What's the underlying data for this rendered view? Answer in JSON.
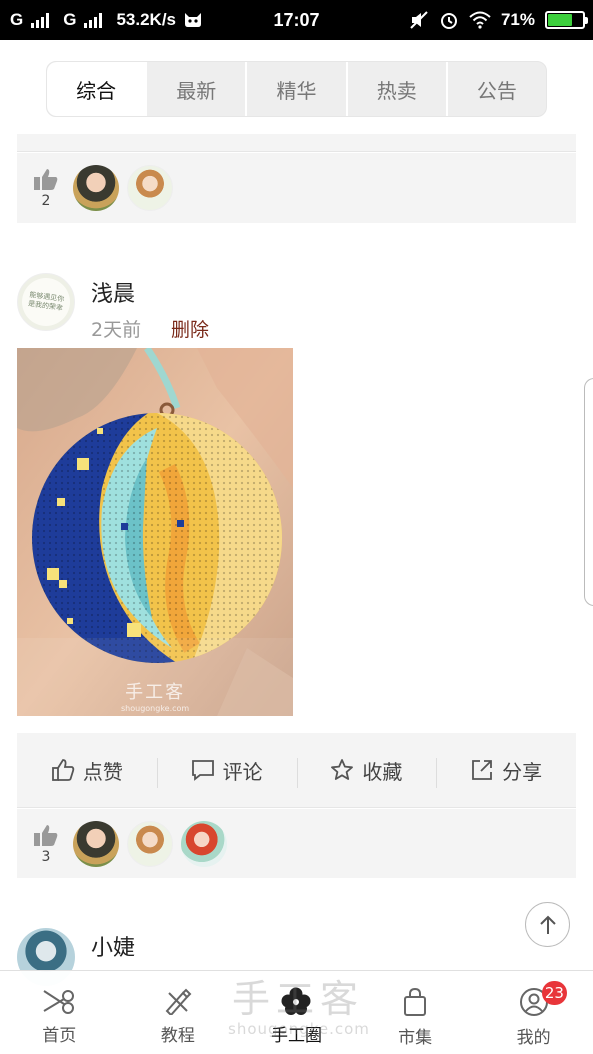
{
  "status_bar": {
    "carrier1": "G",
    "carrier2": "G",
    "speed": "53.2K/s",
    "time": "17:07",
    "battery": "71%",
    "battery_level": 0.71
  },
  "tabs": [
    {
      "label": "综合",
      "active": true
    },
    {
      "label": "最新",
      "active": false
    },
    {
      "label": "精华",
      "active": false
    },
    {
      "label": "热卖",
      "active": false
    },
    {
      "label": "公告",
      "active": false
    }
  ],
  "prev_post": {
    "like_count": "2"
  },
  "post": {
    "author": "浅晨",
    "time": "2天前",
    "delete_label": "删除",
    "avatar_text": "能够遇见你是我的荣幸",
    "image_watermark": "手工客",
    "image_watermark_url": "shougongke.com",
    "actions": {
      "like": "点赞",
      "comment": "评论",
      "favorite": "收藏",
      "share": "分享"
    },
    "like_count": "3"
  },
  "next_post": {
    "author": "小婕"
  },
  "bottom_nav": [
    {
      "label": "首页",
      "icon": "scissors-icon"
    },
    {
      "label": "教程",
      "icon": "pencil-ruler-icon"
    },
    {
      "label": "手工圈",
      "icon": "flower-icon",
      "active": true
    },
    {
      "label": "市集",
      "icon": "bag-icon"
    },
    {
      "label": "我的",
      "icon": "user-icon",
      "badge": "23"
    }
  ],
  "brand_watermark": {
    "text": "手工客",
    "url": "shougongke.com"
  },
  "colors": {
    "accent": "#e8353a",
    "delete": "#7a2a1a",
    "bg_panel": "#f4f4f4"
  }
}
